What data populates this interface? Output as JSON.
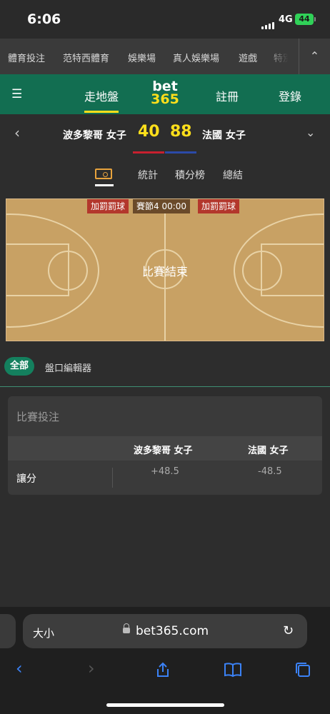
{
  "status": {
    "time": "6:06",
    "network": "4G",
    "battery": "44"
  },
  "topnav": {
    "items": [
      "體育投注",
      "范特西體育",
      "娛樂場",
      "真人娛樂場",
      "遊戲",
      "特別"
    ],
    "collapse_icon": "chevron-up-icon"
  },
  "header": {
    "menu_icon": "hamburger-icon",
    "live": "走地盤",
    "logo_top": "bet",
    "logo_bottom": "365",
    "register": "註冊",
    "login": "登錄",
    "brand_color": "#126e51",
    "accent": "#ffdf1b"
  },
  "scoreboard": {
    "home": "波多黎哥 女子",
    "home_score": "40",
    "away_score": "88",
    "away": "法國 女子",
    "home_color": "#c8202f",
    "away_color": "#2b4aa8"
  },
  "tabs": {
    "court_icon": "basketball-court-icon",
    "stats": "統計",
    "standings": "積分榜",
    "summary": "總結"
  },
  "court": {
    "home_badge": "加罰罰球",
    "period": "賽節4",
    "clock": "00:00",
    "away_badge": "加罰罰球",
    "status": "比賽結束"
  },
  "market_tabs": {
    "all": "全部",
    "editor": "盤口編輯器"
  },
  "market": {
    "title": "比賽投注",
    "col_home": "波多黎哥 女子",
    "col_away": "法國 女子",
    "row_label": "讓分",
    "home_odds": "+48.5",
    "away_odds": "-48.5"
  },
  "browser": {
    "text_size": "大小",
    "domain": "bet365.com"
  }
}
